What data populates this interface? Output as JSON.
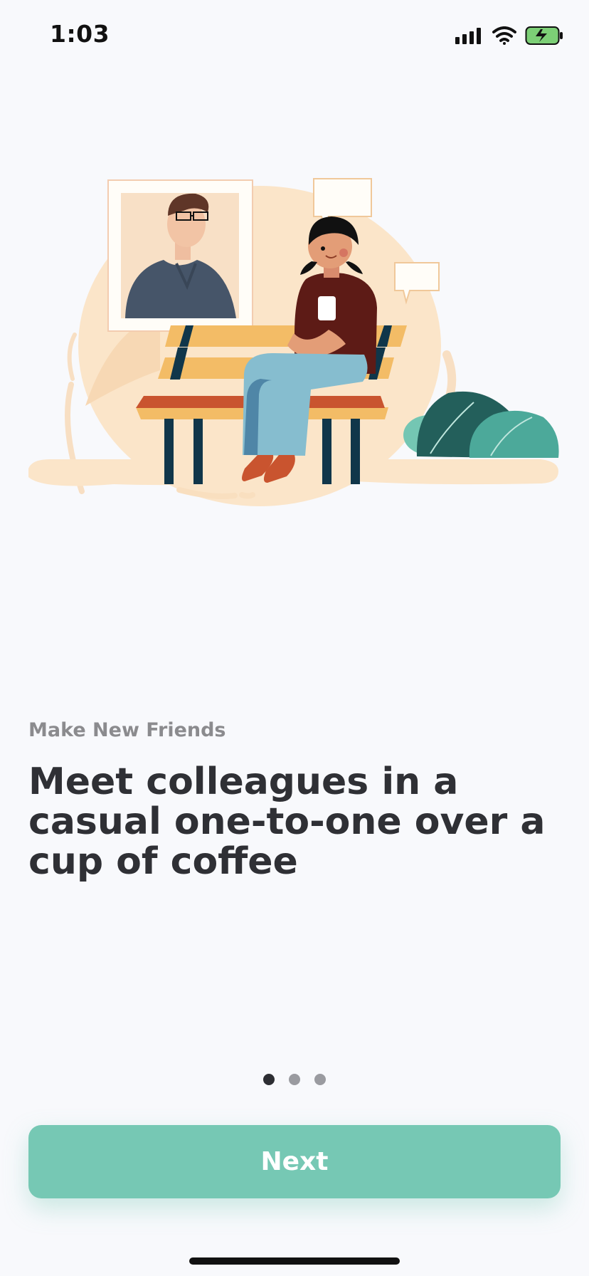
{
  "status_bar": {
    "time": "1:03",
    "icons": [
      "signal-icon",
      "wifi-icon",
      "battery-charging-icon"
    ]
  },
  "onboarding": {
    "eyebrow": "Make New Friends",
    "headline": "Meet colleagues in a casual one-to-one over a cup of coffee",
    "page_indicator": {
      "total": 3,
      "active_index": 0
    }
  },
  "actions": {
    "next_label": "Next"
  },
  "colors": {
    "background": "#f8f9fc",
    "button": "#76c8b4",
    "text_primary": "#2f3035",
    "text_secondary": "#8b8b8e",
    "dot_active": "#2d2e33",
    "dot_inactive": "#9a9ba0"
  }
}
